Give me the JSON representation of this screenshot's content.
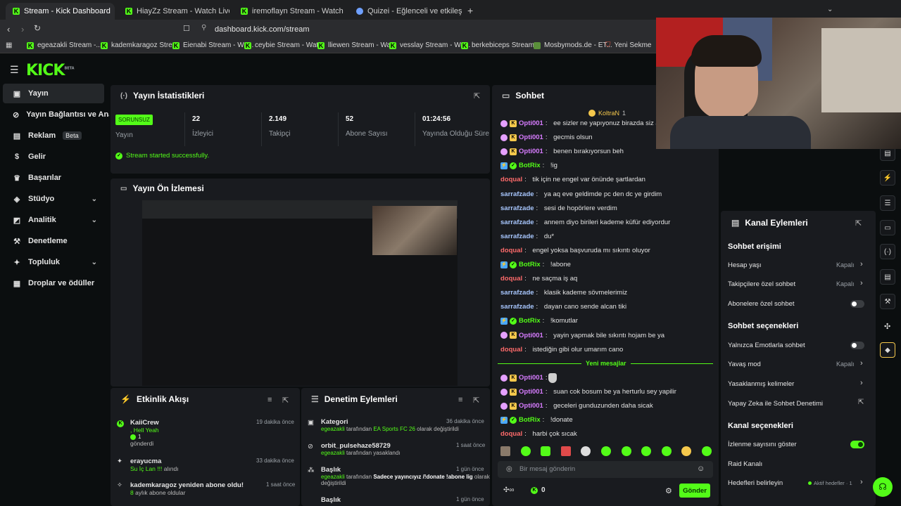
{
  "browser": {
    "tabs": [
      {
        "label": "Stream - Kick Dashboard",
        "active": true
      },
      {
        "label": "HiayZz Stream - Watch Live on Kick"
      },
      {
        "label": "iremoflayn Stream - Watch Live on Ki"
      },
      {
        "label": "Quizei - Eğlenceli ve etkileşimli quizle"
      }
    ],
    "url": "dashboard.kick.com/stream",
    "bookmarks": [
      "egeazakli Stream -...",
      "kademkaragoz Stre...",
      "Eienabi Stream - Wa...",
      "ceybie Stream - Wat...",
      "lliewen Stream - Wa...",
      "vesslay Stream - Wa...",
      "berkebiceps Stream...",
      "Mosbymods.de - ET...",
      "Yeni Sekme"
    ]
  },
  "logo": "KICK",
  "logo_sup": "BETA",
  "sidebar": {
    "items": [
      {
        "label": "Yayın",
        "icon": "video-icon",
        "active": true
      },
      {
        "label": "Yayın Bağlantısı ve Anahtarı",
        "icon": "link-icon"
      },
      {
        "label": "Reklam",
        "icon": "ad-icon",
        "badge": "Beta"
      },
      {
        "label": "Gelir",
        "icon": "dollar-icon"
      },
      {
        "label": "Başarılar",
        "icon": "trophy-icon"
      },
      {
        "label": "Stüdyo",
        "icon": "studio-icon",
        "expand": true
      },
      {
        "label": "Analitik",
        "icon": "chart-icon",
        "expand": true
      },
      {
        "label": "Denetleme",
        "icon": "hammer-icon"
      },
      {
        "label": "Topluluk",
        "icon": "community-icon",
        "expand": true
      },
      {
        "label": "Droplar ve ödüller",
        "icon": "gift-icon"
      }
    ]
  },
  "stats": {
    "title": "Yayın İstatistikleri",
    "status_badge": "SORUNSUZ",
    "status_label": "Yayın",
    "items": [
      {
        "value": "22",
        "label": "İzleyici"
      },
      {
        "value": "2.149",
        "label": "Takipçi"
      },
      {
        "value": "52",
        "label": "Abone Sayısı"
      },
      {
        "value": "01:24:56",
        "label": "Yayında Olduğu Süre"
      }
    ],
    "success_msg": "Stream started successfully."
  },
  "preview": {
    "title": "Yayın Ön İzlemesi"
  },
  "activity": {
    "title": "Etkinlik Akışı",
    "items": [
      {
        "user": "KaiiCrew",
        "line2": ", Hell Yeah",
        "line3": "1",
        "line4": "gönderdi",
        "time": "19 dakika önce"
      },
      {
        "user": "erayucma",
        "line2": "Su İç Lan !!!",
        "line2b": "alındı",
        "time": "33 dakika önce"
      },
      {
        "user": "kademkaragoz yeniden abone oldu!",
        "line2": "8",
        "line2b": "aylık abone oldular",
        "time": "1 saat önce"
      }
    ]
  },
  "moderation": {
    "title": "Denetim Eylemleri",
    "items": [
      {
        "title": "Kategori",
        "by": "egeazakli",
        "mid": "tarafından",
        "val": "EA Sports FC 26",
        "end": "olarak değiştirildi",
        "time": "36 dakika önce"
      },
      {
        "title": "orbit_pulsehaze58729",
        "by": "egeazakli",
        "mid": "tarafından yasaklandı",
        "time": "1 saat önce"
      },
      {
        "title": "Başlık",
        "by": "egeazakli",
        "mid": "tarafından",
        "val": "Sadece yayıncıyız /!donate !abone lig",
        "end": "olarak",
        "end2": "değiştirildi",
        "time": "1 gün önce"
      },
      {
        "title": "Başlık",
        "time": "1 gün önce"
      }
    ]
  },
  "chat": {
    "title": "Sohbet",
    "pinned": "KoltraN",
    "pinned_count": "1",
    "messages": [
      {
        "user": "Opti001",
        "type": "p",
        "text": "ee sizler ne yapıyonuz birazda siz anlatın"
      },
      {
        "user": "Opti001",
        "type": "p",
        "text": "gecmis olsun"
      },
      {
        "user": "Opti001",
        "type": "p",
        "text": "benen bırakıyorsun beh"
      },
      {
        "user": "BotRix",
        "type": "g",
        "text": "!ig"
      },
      {
        "user": "doqual",
        "type": "r",
        "text": "tik için ne engel var önünde şartlardan"
      },
      {
        "user": "sarrafzade",
        "type": "b",
        "text": "ya aq eve geldimde pc den dc ye girdim"
      },
      {
        "user": "sarrafzade",
        "type": "b",
        "text": "sesi de hopörlere verdim"
      },
      {
        "user": "sarrafzade",
        "type": "b",
        "text": "annem diyo birileri kademe küfür ediyordur"
      },
      {
        "user": "sarrafzade",
        "type": "b",
        "text": "du*"
      },
      {
        "user": "doqual",
        "type": "r",
        "text": "engel yoksa başvuruda mı sıkıntı oluyor"
      },
      {
        "user": "BotRix",
        "type": "g",
        "text": "!abone"
      },
      {
        "user": "doqual",
        "type": "r",
        "text": "ne saçma iş aq"
      },
      {
        "user": "sarrafzade",
        "type": "b",
        "text": "klasik kademe sövmelerimiz"
      },
      {
        "user": "sarrafzade",
        "type": "b",
        "text": "dayan cano sende alcan tiki"
      },
      {
        "user": "BotRix",
        "type": "g",
        "text": "!komutlar"
      },
      {
        "user": "Opti001",
        "type": "p",
        "text": "yayin yapmak bile sıkıntı hojam be ya"
      },
      {
        "user": "doqual",
        "type": "r",
        "text": "istediğin gibi olur umarım cano"
      }
    ],
    "new_messages_label": "Yeni mesajlar",
    "new_messages": [
      {
        "user": "Opti001",
        "type": "p",
        "text": ""
      },
      {
        "user": "Opti001",
        "type": "p",
        "text": "suan cok bosum be ya herturlu sey yapilir"
      },
      {
        "user": "Opti001",
        "type": "p",
        "text": "geceleri gunduzunden daha sicak"
      },
      {
        "user": "BotRix",
        "type": "g",
        "text": "!donate"
      },
      {
        "user": "doqual",
        "type": "r",
        "text": "harbi çok sıcak"
      }
    ],
    "input_placeholder": "Bir mesaj gönderin",
    "points": "0",
    "send_label": "Gönder"
  },
  "channel_actions": {
    "title": "Kanal Eylemleri",
    "chat_access": "Sohbet erişimi",
    "account_age": "Hesap yaşı",
    "account_age_val": "Kapalı",
    "followers_only": "Takipçilere özel sohbet",
    "followers_only_val": "Kapalı",
    "subs_only": "Abonelere özel sohbet",
    "chat_options": "Sohbet seçenekleri",
    "emote_only": "Yalnızca Emotlarla sohbet",
    "slow_mode": "Yavaş mod",
    "slow_mode_val": "Kapalı",
    "banned_words": "Yasaklanmış kelimeler",
    "ai_mod": "Yapay Zeka ile Sohbet Denetimi",
    "channel_options": "Kanal seçenekleri",
    "show_viewers": "İzlenme sayısını göster",
    "raid": "Raid Kanalı",
    "goals": "Hedefleri belirleyin",
    "goals_val": "Aktif hedefler · 1"
  },
  "colors": {
    "accent": "#53fc18",
    "bg": "#0b0e0f",
    "panel": "#191b1f"
  }
}
